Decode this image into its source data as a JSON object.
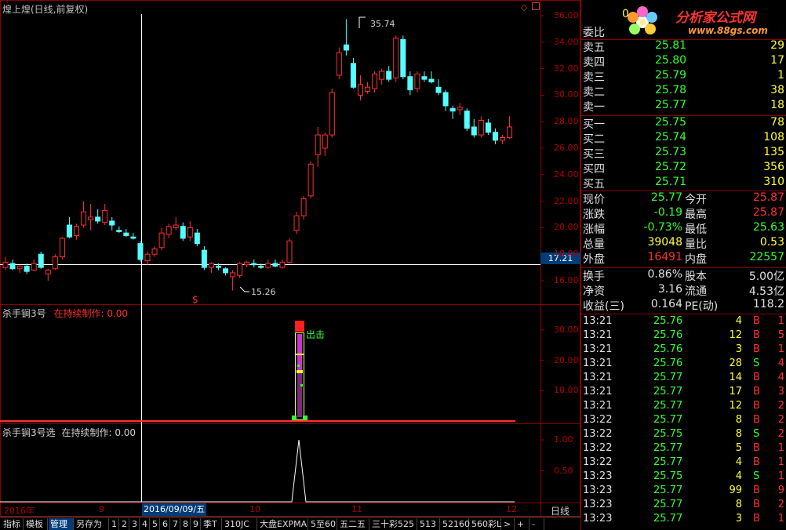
{
  "main_title": "煌上煌(日线,前复权)",
  "indicator1_title": "杀手锏3号",
  "indicator1_subtitle": "在持续制作: 0.00",
  "indicator2_title": "杀手锏3号选",
  "indicator2_subtitle": "在持续制作: 0.00",
  "annot_high": "35.74",
  "annot_low": "15.26",
  "annot_signal": "出击",
  "dollar_mark": "$",
  "price_cursor_label": "17.21",
  "price_axis": [
    "36.00",
    "34.00",
    "32.00",
    "30.00",
    "28.00",
    "26.00",
    "24.00",
    "22.00",
    "20.00",
    "18.00",
    "16.00"
  ],
  "ind1_axis": [
    "30.00",
    "20.00",
    "10.00"
  ],
  "ind2_axis": [
    "1.00",
    "0.50"
  ],
  "time_axis": {
    "year": "2016年",
    "m9": "9",
    "date": "2016/09/09/五",
    "m10": "10",
    "m11": "11",
    "m12": "12",
    "period": "日线"
  },
  "logo": {
    "brand": "分析家公式网",
    "url": "www.88gs.com",
    "prefix": "0"
  },
  "colors": {
    "up": "#ff3030",
    "down": "#54ffff",
    "frame": "#8a0000",
    "green": "#33ff33",
    "yellow": "#ffff33"
  },
  "chart_data": {
    "type": "candlestick",
    "ylim": [
      15.0,
      36.5
    ],
    "candles": [
      {
        "o": 17.0,
        "h": 17.8,
        "l": 16.8,
        "c": 17.4
      },
      {
        "o": 17.3,
        "h": 17.6,
        "l": 16.8,
        "c": 16.9
      },
      {
        "o": 16.9,
        "h": 17.2,
        "l": 16.6,
        "c": 17.1
      },
      {
        "o": 17.1,
        "h": 17.3,
        "l": 16.5,
        "c": 16.7
      },
      {
        "o": 16.8,
        "h": 17.6,
        "l": 16.7,
        "c": 17.3
      },
      {
        "o": 18.0,
        "h": 18.2,
        "l": 16.9,
        "c": 17.0
      },
      {
        "o": 16.5,
        "h": 16.9,
        "l": 16.0,
        "c": 16.8
      },
      {
        "o": 16.9,
        "h": 18.0,
        "l": 16.8,
        "c": 17.8
      },
      {
        "o": 17.8,
        "h": 19.3,
        "l": 17.6,
        "c": 19.2
      },
      {
        "o": 20.2,
        "h": 20.8,
        "l": 19.2,
        "c": 19.3
      },
      {
        "o": 19.4,
        "h": 20.3,
        "l": 19.1,
        "c": 20.1
      },
      {
        "o": 20.2,
        "h": 22.0,
        "l": 20.0,
        "c": 21.2
      },
      {
        "o": 20.6,
        "h": 21.8,
        "l": 19.8,
        "c": 20.8
      },
      {
        "o": 20.8,
        "h": 21.4,
        "l": 20.3,
        "c": 20.5
      },
      {
        "o": 20.4,
        "h": 21.8,
        "l": 20.2,
        "c": 21.3
      },
      {
        "o": 20.5,
        "h": 20.8,
        "l": 19.8,
        "c": 20.2
      },
      {
        "o": 19.8,
        "h": 20.1,
        "l": 19.6,
        "c": 19.7
      },
      {
        "o": 19.6,
        "h": 19.9,
        "l": 19.3,
        "c": 19.4
      },
      {
        "o": 19.3,
        "h": 19.6,
        "l": 19.1,
        "c": 19.2
      },
      {
        "o": 18.8,
        "h": 19.0,
        "l": 17.4,
        "c": 17.6
      },
      {
        "o": 17.5,
        "h": 18.2,
        "l": 17.2,
        "c": 18.0
      },
      {
        "o": 18.0,
        "h": 18.6,
        "l": 17.8,
        "c": 18.4
      },
      {
        "o": 18.5,
        "h": 20.0,
        "l": 18.3,
        "c": 19.6
      },
      {
        "o": 19.5,
        "h": 20.3,
        "l": 19.2,
        "c": 20.1
      },
      {
        "o": 20.0,
        "h": 20.8,
        "l": 19.8,
        "c": 20.2
      },
      {
        "o": 20.1,
        "h": 20.4,
        "l": 19.0,
        "c": 19.2
      },
      {
        "o": 19.3,
        "h": 20.5,
        "l": 19.0,
        "c": 20.0
      },
      {
        "o": 19.6,
        "h": 19.9,
        "l": 18.6,
        "c": 18.8
      },
      {
        "o": 18.3,
        "h": 18.6,
        "l": 16.8,
        "c": 17.0
      },
      {
        "o": 17.0,
        "h": 17.4,
        "l": 16.6,
        "c": 17.3
      },
      {
        "o": 17.1,
        "h": 17.3,
        "l": 16.8,
        "c": 17.0
      },
      {
        "o": 16.9,
        "h": 17.0,
        "l": 16.4,
        "c": 16.6
      },
      {
        "o": 16.3,
        "h": 16.8,
        "l": 15.26,
        "c": 16.6
      },
      {
        "o": 16.4,
        "h": 17.4,
        "l": 16.2,
        "c": 17.3
      },
      {
        "o": 17.2,
        "h": 17.5,
        "l": 17.0,
        "c": 17.4
      },
      {
        "o": 17.3,
        "h": 17.6,
        "l": 17.0,
        "c": 17.2
      },
      {
        "o": 17.1,
        "h": 17.3,
        "l": 16.9,
        "c": 17.0
      },
      {
        "o": 17.0,
        "h": 17.6,
        "l": 16.9,
        "c": 17.3
      },
      {
        "o": 17.3,
        "h": 17.6,
        "l": 17.0,
        "c": 17.1
      },
      {
        "o": 17.0,
        "h": 17.6,
        "l": 16.9,
        "c": 17.4
      },
      {
        "o": 17.4,
        "h": 19.2,
        "l": 17.3,
        "c": 19.0
      },
      {
        "o": 19.8,
        "h": 21.2,
        "l": 19.5,
        "c": 20.9
      },
      {
        "o": 20.9,
        "h": 22.4,
        "l": 20.6,
        "c": 22.2
      },
      {
        "o": 22.4,
        "h": 25.0,
        "l": 22.2,
        "c": 24.8
      },
      {
        "o": 25.5,
        "h": 27.6,
        "l": 24.6,
        "c": 27.0
      },
      {
        "o": 26.0,
        "h": 27.2,
        "l": 25.4,
        "c": 27.0
      },
      {
        "o": 27.0,
        "h": 30.5,
        "l": 26.8,
        "c": 30.2
      },
      {
        "o": 31.5,
        "h": 33.6,
        "l": 31.2,
        "c": 33.2
      },
      {
        "o": 33.8,
        "h": 35.74,
        "l": 33.0,
        "c": 33.4
      },
      {
        "o": 32.4,
        "h": 32.8,
        "l": 30.5,
        "c": 30.6
      },
      {
        "o": 30.0,
        "h": 31.5,
        "l": 29.6,
        "c": 30.8
      },
      {
        "o": 30.3,
        "h": 31.0,
        "l": 30.1,
        "c": 30.6
      },
      {
        "o": 30.5,
        "h": 31.8,
        "l": 30.2,
        "c": 31.6
      },
      {
        "o": 31.2,
        "h": 32.0,
        "l": 30.8,
        "c": 31.8
      },
      {
        "o": 31.8,
        "h": 32.2,
        "l": 31.0,
        "c": 31.2
      },
      {
        "o": 31.3,
        "h": 34.5,
        "l": 31.0,
        "c": 34.3
      },
      {
        "o": 34.2,
        "h": 34.5,
        "l": 31.2,
        "c": 31.4
      },
      {
        "o": 31.4,
        "h": 31.8,
        "l": 30.0,
        "c": 30.4
      },
      {
        "o": 30.5,
        "h": 31.8,
        "l": 30.2,
        "c": 31.6
      },
      {
        "o": 31.4,
        "h": 31.8,
        "l": 31.0,
        "c": 31.2
      },
      {
        "o": 31.2,
        "h": 31.8,
        "l": 30.9,
        "c": 31.0
      },
      {
        "o": 30.6,
        "h": 31.2,
        "l": 30.0,
        "c": 30.2
      },
      {
        "o": 30.2,
        "h": 30.4,
        "l": 28.8,
        "c": 29.2
      },
      {
        "o": 29.0,
        "h": 29.2,
        "l": 28.2,
        "c": 28.8
      },
      {
        "o": 28.9,
        "h": 29.4,
        "l": 28.5,
        "c": 29.1
      },
      {
        "o": 28.8,
        "h": 29.0,
        "l": 27.3,
        "c": 27.5
      },
      {
        "o": 27.6,
        "h": 28.2,
        "l": 26.8,
        "c": 27.0
      },
      {
        "o": 27.0,
        "h": 28.4,
        "l": 26.8,
        "c": 28.1
      },
      {
        "o": 27.9,
        "h": 28.2,
        "l": 27.0,
        "c": 27.2
      },
      {
        "o": 27.2,
        "h": 27.5,
        "l": 26.3,
        "c": 26.6
      },
      {
        "o": 26.6,
        "h": 27.0,
        "l": 26.3,
        "c": 26.8
      },
      {
        "o": 26.8,
        "h": 28.4,
        "l": 26.7,
        "c": 27.6
      }
    ]
  },
  "quote": {
    "weibi_label": "委比",
    "asks": [
      {
        "label": "卖五",
        "price": "25.81",
        "vol": "29"
      },
      {
        "label": "卖四",
        "price": "25.80",
        "vol": "17"
      },
      {
        "label": "卖三",
        "price": "25.79",
        "vol": "1"
      },
      {
        "label": "卖二",
        "price": "25.78",
        "vol": "38"
      },
      {
        "label": "卖一",
        "price": "25.77",
        "vol": "18"
      }
    ],
    "bids": [
      {
        "label": "买一",
        "price": "25.75",
        "vol": "78"
      },
      {
        "label": "买二",
        "price": "25.74",
        "vol": "108"
      },
      {
        "label": "买三",
        "price": "25.73",
        "vol": "135"
      },
      {
        "label": "买四",
        "price": "25.72",
        "vol": "356"
      },
      {
        "label": "买五",
        "price": "25.71",
        "vol": "310"
      }
    ],
    "stats": [
      {
        "l1": "现价",
        "v1": "25.77",
        "c1": "#33ff33",
        "l2": "今开",
        "v2": "25.87",
        "c2": "#ff3030"
      },
      {
        "l1": "涨跌",
        "v1": "-0.19",
        "c1": "#33ff33",
        "l2": "最高",
        "v2": "25.87",
        "c2": "#ff3030"
      },
      {
        "l1": "涨幅",
        "v1": "-0.73%",
        "c1": "#33ff33",
        "l2": "最低",
        "v2": "25.63",
        "c2": "#33ff33"
      },
      {
        "l1": "总量",
        "v1": "39048",
        "c1": "#ffff33",
        "l2": "量比",
        "v2": "0.53",
        "c2": "#ffff33"
      },
      {
        "l1": "外盘",
        "v1": "16491",
        "c1": "#ff3030",
        "l2": "内盘",
        "v2": "22557",
        "c2": "#33ff33"
      }
    ],
    "fin": [
      {
        "l1": "换手",
        "v1": "0.86%",
        "l2": "股本",
        "v2": "5.00亿"
      },
      {
        "l1": "净资",
        "v1": "3.16",
        "l2": "流通",
        "v2": "4.53亿"
      },
      {
        "l1": "收益(三)",
        "v1": "0.164",
        "l2": "PE(动)",
        "v2": "118.2"
      }
    ]
  },
  "ticks": [
    {
      "t": "13:21",
      "p": "25.76",
      "v": "4",
      "d": "B",
      "n": "1"
    },
    {
      "t": "13:21",
      "p": "25.76",
      "v": "12",
      "d": "B",
      "n": "5"
    },
    {
      "t": "13:21",
      "p": "25.76",
      "v": "3",
      "d": "B",
      "n": "1"
    },
    {
      "t": "13:21",
      "p": "25.76",
      "v": "28",
      "d": "S",
      "n": "4"
    },
    {
      "t": "13:21",
      "p": "25.77",
      "v": "14",
      "d": "B",
      "n": "4"
    },
    {
      "t": "13:21",
      "p": "25.77",
      "v": "17",
      "d": "B",
      "n": "3"
    },
    {
      "t": "13:21",
      "p": "25.77",
      "v": "12",
      "d": "B",
      "n": "2"
    },
    {
      "t": "13:22",
      "p": "25.77",
      "v": "8",
      "d": "B",
      "n": "2"
    },
    {
      "t": "13:22",
      "p": "25.75",
      "v": "8",
      "d": "S",
      "n": "2"
    },
    {
      "t": "13:22",
      "p": "25.77",
      "v": "5",
      "d": "B",
      "n": "1"
    },
    {
      "t": "13:22",
      "p": "25.77",
      "v": "4",
      "d": "B",
      "n": "1"
    },
    {
      "t": "13:23",
      "p": "25.75",
      "v": "4",
      "d": "S",
      "n": "1"
    },
    {
      "t": "13:23",
      "p": "25.77",
      "v": "99",
      "d": "B",
      "n": "9"
    },
    {
      "t": "13:23",
      "p": "25.77",
      "v": "8",
      "d": "B",
      "n": "2"
    },
    {
      "t": "13:23",
      "p": "25.77",
      "v": "3",
      "d": "B",
      "n": "1"
    }
  ],
  "bottom_tabs": [
    "指标",
    "模板",
    "管理",
    "另存为",
    "1",
    "2",
    "3",
    "4",
    "5",
    "6",
    "7",
    "8",
    "9",
    "季T",
    "310JC",
    "大盘EXPMA",
    "5至60",
    "五二五",
    "三十彩525",
    "513",
    "52160",
    "560彩L",
    ">",
    "+",
    "-"
  ]
}
